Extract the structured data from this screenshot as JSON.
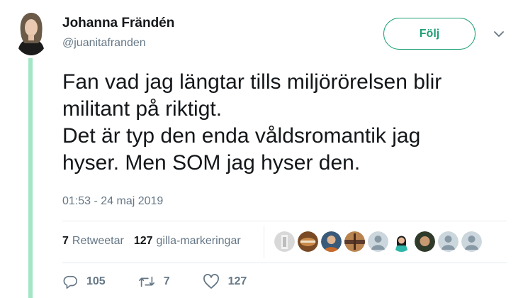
{
  "author": {
    "name": "Johanna Frändén",
    "handle": "@juanitafranden"
  },
  "follow_button": {
    "label": "Följ"
  },
  "tweet": {
    "lines": [
      "Fan vad jag längtar tills miljörörelsen blir",
      "militant på riktigt.",
      "Det är typ den enda våldsromantik jag",
      "hyser. Men SOM jag hyser den."
    ],
    "timestamp": "01:53 - 24 maj 2019"
  },
  "stats": {
    "retweets_count": "7",
    "retweets_label": "Retweetar",
    "likes_count": "127",
    "likes_label": "gilla-markeringar"
  },
  "actions": {
    "replies": "105",
    "retweets": "7",
    "likes": "127"
  },
  "colors": {
    "accent": "#1ea073",
    "thread_line": "#a3e6c6",
    "muted_text": "#657786",
    "divider": "#e6ecf0"
  }
}
